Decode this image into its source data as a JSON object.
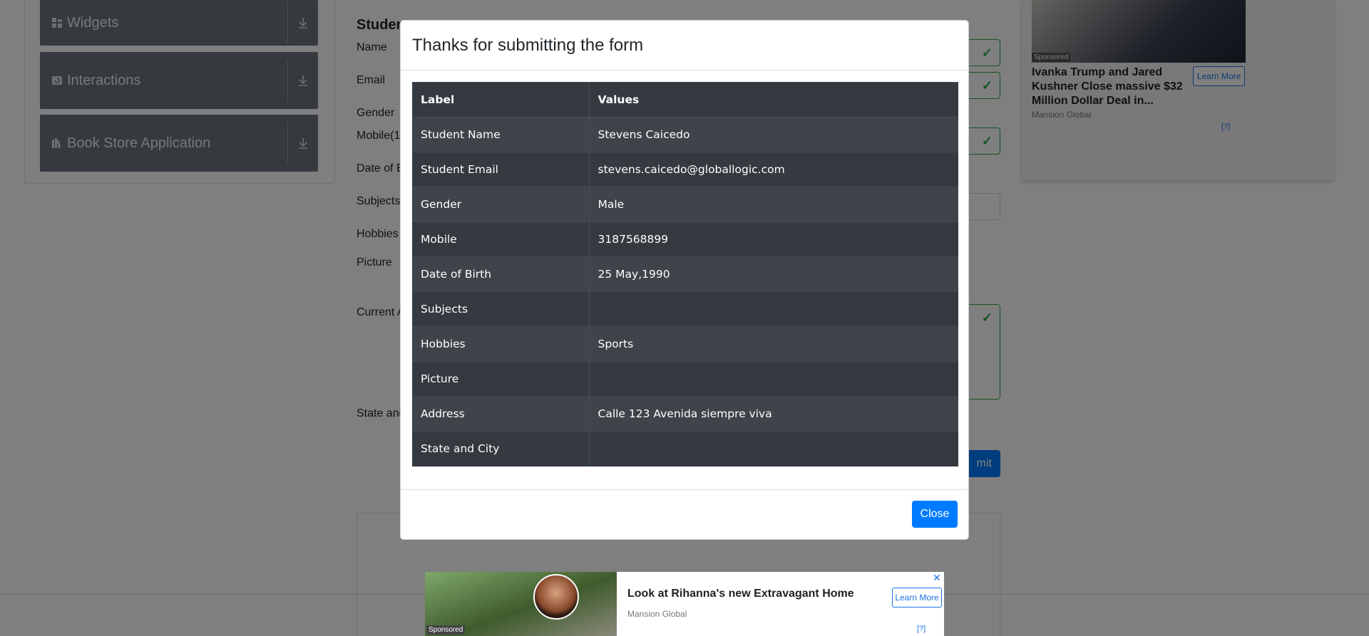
{
  "sidebar": {
    "groups": [
      {
        "label": "Widgets",
        "icon": "widgets-icon"
      },
      {
        "label": "Interactions",
        "icon": "interactions-icon"
      },
      {
        "label": "Book Store Application",
        "icon": "book-icon"
      }
    ]
  },
  "form": {
    "title": "Studen",
    "labels": [
      "Name",
      "Email",
      "Gender",
      "Mobile(1",
      "Date of B",
      "Subjects",
      "Hobbies",
      "Picture",
      "Current A",
      "State and"
    ],
    "submit_label": "mit"
  },
  "ads": {
    "top": {
      "sponsored": "Sponsored",
      "headline": "Ivanka Trump and Jared Kushner Close massive $32 Million Dollar Deal in...",
      "brand": "Mansion Global",
      "cta": "Learn More",
      "adchoices": "[?]"
    },
    "bottom": {
      "sponsored": "Sponsored",
      "headline": "Look at Rihanna's new Extravagant Home",
      "brand": "Mansion Global",
      "cta": "Learn More",
      "close": "✕",
      "adchoices": "[?]"
    }
  },
  "modal": {
    "title": "Thanks for submitting the form",
    "table": {
      "headers": [
        "Label",
        "Values"
      ],
      "rows": [
        {
          "label": "Student Name",
          "value": "Stevens Caicedo"
        },
        {
          "label": "Student Email",
          "value": "stevens.caicedo@globallogic.com"
        },
        {
          "label": "Gender",
          "value": "Male"
        },
        {
          "label": "Mobile",
          "value": "3187568899"
        },
        {
          "label": "Date of Birth",
          "value": "25 May,1990"
        },
        {
          "label": "Subjects",
          "value": ""
        },
        {
          "label": "Hobbies",
          "value": "Sports"
        },
        {
          "label": "Picture",
          "value": ""
        },
        {
          "label": "Address",
          "value": "Calle 123 Avenida siempre viva"
        },
        {
          "label": "State and City",
          "value": ""
        }
      ]
    },
    "close_label": "Close"
  }
}
